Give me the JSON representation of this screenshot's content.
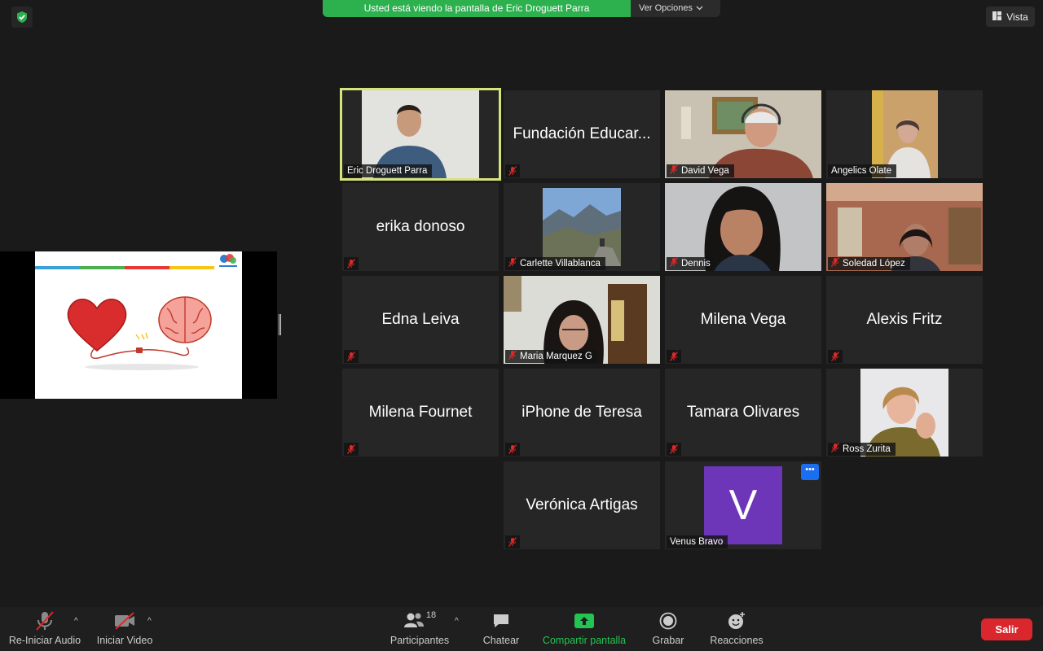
{
  "banner": {
    "text": "Usted está viendo la pantalla de Eric Droguett Parra",
    "options_label": "Ver Opciones"
  },
  "view_button_label": "Vista",
  "participants": [
    {
      "name": "Eric Droguett Parra",
      "has_video": true,
      "muted": true,
      "active_speaker": true
    },
    {
      "name": "Fundación Educar...",
      "has_video": false,
      "muted": true
    },
    {
      "name": "David Vega",
      "has_video": true,
      "muted": true
    },
    {
      "name": "Angelics Olate",
      "has_video": true,
      "muted": false
    },
    {
      "name": "erika donoso",
      "has_video": false,
      "muted": true
    },
    {
      "name": "Carlette Villablanca",
      "has_video": true,
      "muted": true
    },
    {
      "name": "Dennis",
      "has_video": true,
      "muted": true
    },
    {
      "name": "Soledad López",
      "has_video": true,
      "muted": true
    },
    {
      "name": "Edna Leiva",
      "has_video": false,
      "muted": true
    },
    {
      "name": "Maria Marquez G",
      "has_video": true,
      "muted": true
    },
    {
      "name": "Milena Vega",
      "has_video": false,
      "muted": true
    },
    {
      "name": "Alexis Fritz",
      "has_video": false,
      "muted": true
    },
    {
      "name": "Milena Fournet",
      "has_video": false,
      "muted": true
    },
    {
      "name": "iPhone de Teresa",
      "has_video": false,
      "muted": true
    },
    {
      "name": "Tamara Olivares",
      "has_video": false,
      "muted": true
    },
    {
      "name": "Ross Zurita",
      "has_video": true,
      "muted": true
    },
    {
      "name": "Verónica Artigas",
      "has_video": false,
      "muted": true
    },
    {
      "name": "Venus Bravo",
      "has_video": false,
      "muted": false,
      "avatar_letter": "V"
    }
  ],
  "toolbar": {
    "audio_label": "Re-Iniciar Audio",
    "video_label": "Iniciar Video",
    "participants_label": "Participantes",
    "participants_count": "18",
    "chat_label": "Chatear",
    "share_label": "Compartir pantalla",
    "record_label": "Grabar",
    "reactions_label": "Reacciones",
    "leave_label": "Salir"
  },
  "colors": {
    "banner_green": "#2db14f",
    "active_speaker_outline": "#d7e37b",
    "share_icon_green": "#23c552",
    "leave_red": "#d9272d",
    "avatar_purple": "#6d35b8",
    "muted_red": "#e02828"
  }
}
